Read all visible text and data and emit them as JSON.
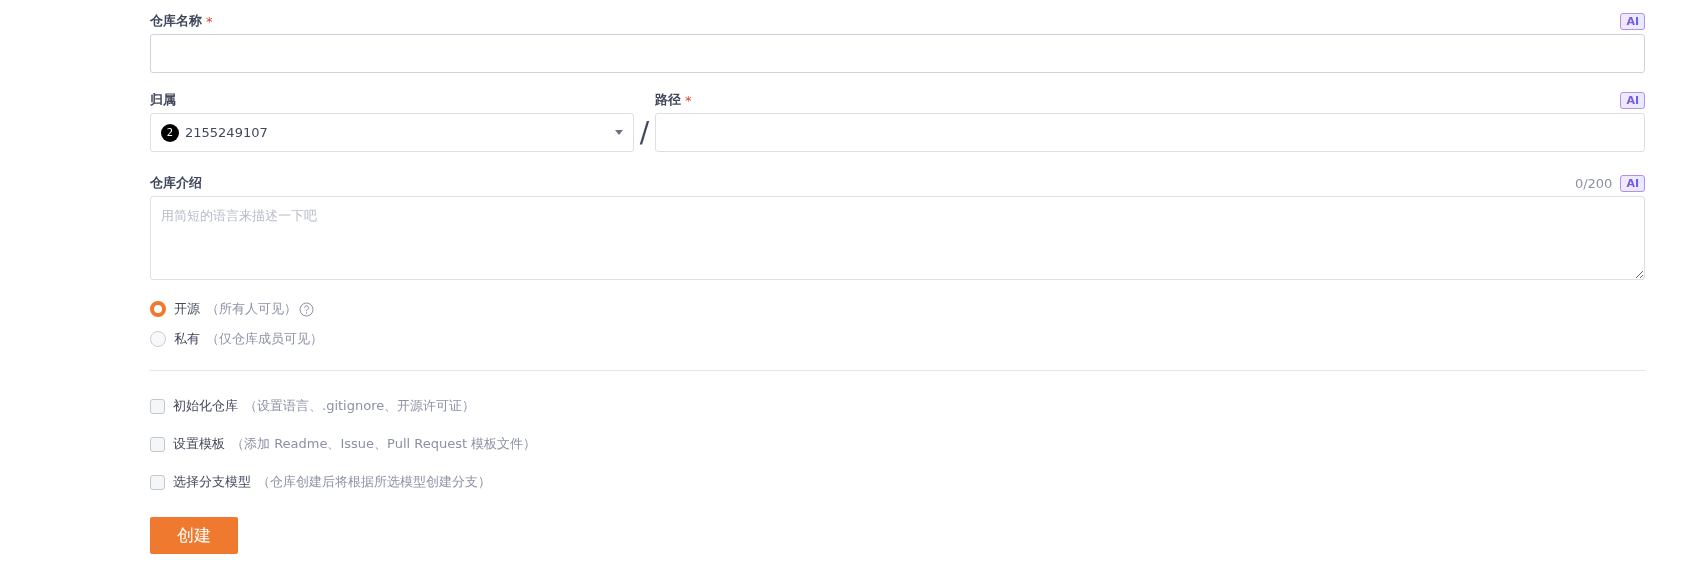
{
  "name_field": {
    "label": "仓库名称",
    "required_mark": "*",
    "ai": "AI"
  },
  "owner_field": {
    "label": "归属",
    "avatar": "2",
    "value": "2155249107"
  },
  "separator": "/",
  "path_field": {
    "label": "路径",
    "required_mark": "*",
    "ai": "AI"
  },
  "description_field": {
    "label": "仓库介绍",
    "counter": "0/200",
    "ai": "AI",
    "placeholder": "用简短的语言来描述一下吧"
  },
  "visibility": [
    {
      "label": "开源",
      "hint": "（所有人可见）",
      "selected": true,
      "help": true
    },
    {
      "label": "私有",
      "hint": "（仅仓库成员可见）",
      "selected": false,
      "help": false
    }
  ],
  "options": [
    {
      "label": "初始化仓库",
      "hint": "（设置语言、.gitignore、开源许可证）",
      "checked": false
    },
    {
      "label": "设置模板",
      "hint": "（添加 Readme、Issue、Pull Request 模板文件）",
      "checked": false
    },
    {
      "label": "选择分支模型",
      "hint": "（仓库创建后将根据所选模型创建分支）",
      "checked": false
    }
  ],
  "submit": "创建"
}
